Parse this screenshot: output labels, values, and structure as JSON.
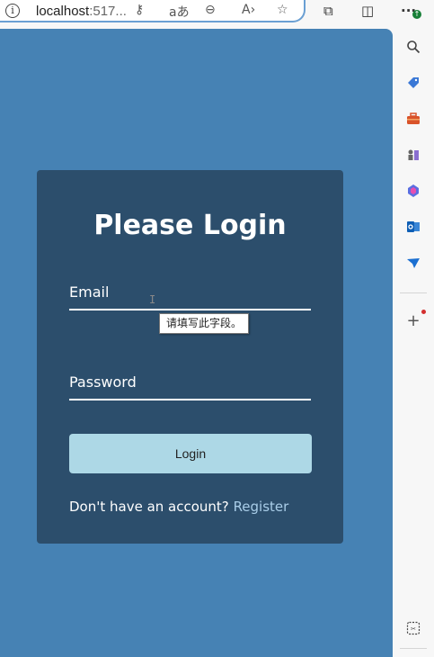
{
  "browser": {
    "url_host": "localhost",
    "url_rest": ":517...",
    "info_icon": "i",
    "more_label": "···"
  },
  "page": {
    "title": "Please Login",
    "email_placeholder": "Email",
    "password_placeholder": "Password",
    "validation_tooltip": "请填写此字段。",
    "login_button": "Login",
    "register_prompt": "Don't have an account?",
    "register_link": "Register"
  },
  "icons": {
    "key": "key-icon",
    "read_aloud_translate": "translate-icon",
    "zoom": "zoom-out-icon",
    "read_aloud": "read-aloud-icon",
    "favorite": "star-icon",
    "extensions": "puzzle-icon",
    "split": "split-screen-icon",
    "sidebar_search": "search-icon",
    "shopping": "tag-icon",
    "tools": "toolbox-icon",
    "games": "chess-icon",
    "copilot": "copilot-icon",
    "outlook": "outlook-icon",
    "send": "send-icon",
    "add": "plus-icon",
    "screenshot": "screenshot-icon"
  },
  "colors": {
    "page_bg": "#4682b4",
    "card_bg": "#2c4e6c",
    "button_bg": "#add8e6",
    "link": "#a9cde8"
  }
}
